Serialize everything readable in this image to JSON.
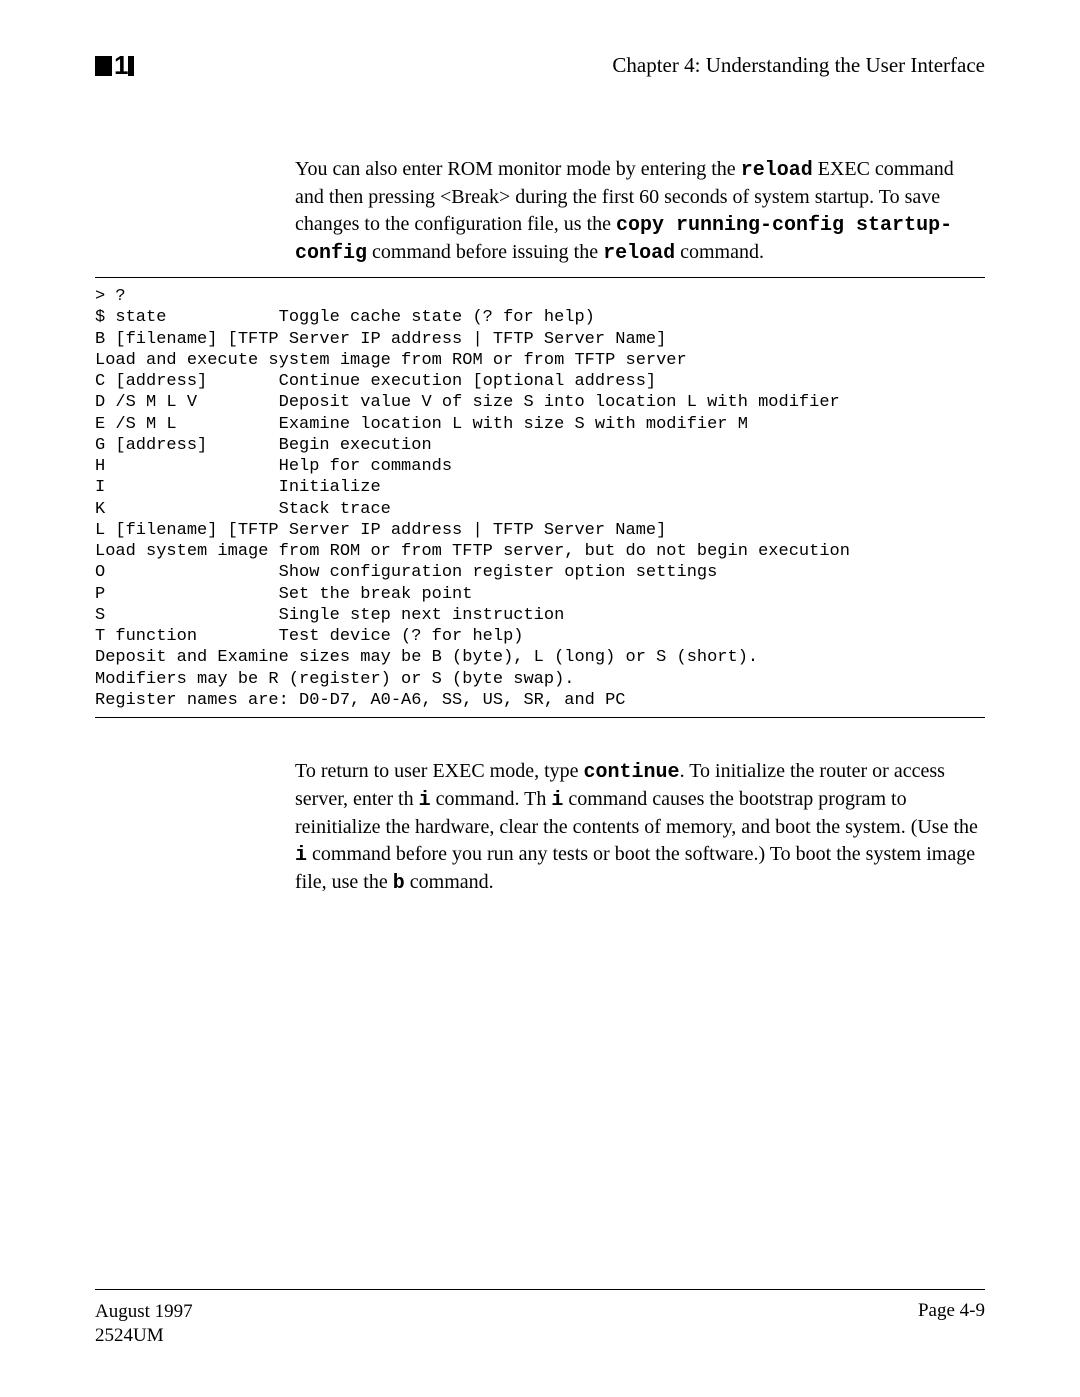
{
  "header": {
    "chapter_title": "Chapter 4: Understanding the User Interface"
  },
  "paragraph1": {
    "t1": "You can also enter ROM monitor mode by entering the ",
    "cmd1": "reload",
    "t2": " EXEC command and then pressing  <Break>  during the first 60 seconds of system startup. To save changes to the configuration file, us the ",
    "cmd2": "copy running-config startup-config",
    "t3": " command before issuing the ",
    "cmd3": "reload",
    "t4": " command."
  },
  "terminal": "> ?\n$ state           Toggle cache state (? for help)\nB [filename] [TFTP Server IP address | TFTP Server Name]\nLoad and execute system image from ROM or from TFTP server\nC [address]       Continue execution [optional address]\nD /S M L V        Deposit value V of size S into location L with modifier\nE /S M L          Examine location L with size S with modifier M\nG [address]       Begin execution\nH                 Help for commands\nI                 Initialize\nK                 Stack trace\nL [filename] [TFTP Server IP address | TFTP Server Name]\nLoad system image from ROM or from TFTP server, but do not begin execution\nO                 Show configuration register option settings\nP                 Set the break point\nS                 Single step next instruction\nT function        Test device (? for help)\nDeposit and Examine sizes may be B (byte), L (long) or S (short).\nModifiers may be R (register) or S (byte swap).\nRegister names are: D0-D7, A0-A6, SS, US, SR, and PC",
  "paragraph2": {
    "t1": "To return to user EXEC mode, type ",
    "cmd1": "continue",
    "t2": ". To initialize the router or access server, enter th  ",
    "cmd2": "i",
    "t3": " command. Th  ",
    "cmd3": "i",
    "t4": " command causes the bootstrap program to reinitialize the hardware, clear the contents of memory, and boot the system. (Use the ",
    "cmd4": "i",
    "t5": " command before you run any tests or boot the software.) To boot the system image file, use the ",
    "cmd5": "b",
    "t6": " command."
  },
  "footer": {
    "date": "August 1997",
    "doc": "2524UM",
    "page": "Page 4-9"
  }
}
